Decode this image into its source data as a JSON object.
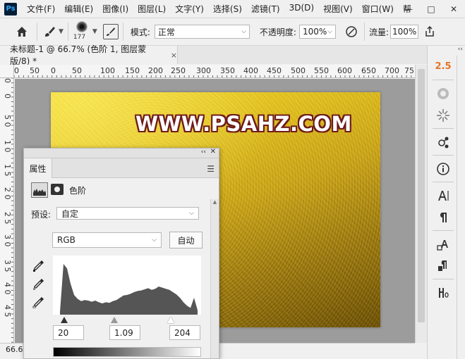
{
  "app": {
    "logo_text": "Ps",
    "menus": [
      "文件(F)",
      "编辑(E)",
      "图像(I)",
      "图层(L)",
      "文字(Y)",
      "选择(S)",
      "滤镜(T)",
      "3D(D)",
      "视图(V)",
      "窗口(W)",
      "帮"
    ],
    "window_controls": [
      "—",
      "□",
      "✕"
    ]
  },
  "options": {
    "brush_size": "177",
    "mode_label": "模式:",
    "mode_value": "正常",
    "opacity_label": "不透明度:",
    "opacity_value": "100%",
    "flow_label": "流量:",
    "flow_value": "100%"
  },
  "document": {
    "tab_title": "未标题-1 @ 66.7% (色阶 1, 图层蒙版/8) *",
    "close_symbol": "×",
    "zoom_status": "66.6",
    "watermark": "WWW.PSAHZ.COM"
  },
  "rulers": {
    "top": [
      "0",
      "50",
      "0",
      "50",
      "100",
      "150",
      "200",
      "250",
      "300",
      "350",
      "400",
      "450",
      "500",
      "550",
      "600",
      "650",
      "700",
      "75"
    ],
    "left": [
      "0",
      "0",
      "5 0",
      "1 0",
      "1 5",
      "2 0",
      "2 5",
      "3 0",
      "3 5",
      "4 0",
      "4 5"
    ]
  },
  "right_dock": {
    "collapse": "‹‹",
    "top_item": "2.5"
  },
  "properties": {
    "collapse": "‹‹",
    "close": "✕",
    "tab_label": "属性",
    "adjustment_name": "色阶",
    "preset_label": "预设:",
    "preset_value": "自定",
    "channel_value": "RGB",
    "auto_button": "自动",
    "input_black": "20",
    "input_gamma": "1.09",
    "input_white": "204",
    "histogram_values": [
      0.05,
      0.9,
      0.82,
      0.55,
      0.35,
      0.28,
      0.24,
      0.26,
      0.25,
      0.23,
      0.25,
      0.22,
      0.2,
      0.22,
      0.21,
      0.24,
      0.26,
      0.3,
      0.34,
      0.35,
      0.37,
      0.4,
      0.42,
      0.43,
      0.45,
      0.47,
      0.44,
      0.46,
      0.5,
      0.48,
      0.46,
      0.44,
      0.4,
      0.36,
      0.3,
      0.22,
      0.16,
      0.12,
      0.3,
      0.08
    ]
  }
}
